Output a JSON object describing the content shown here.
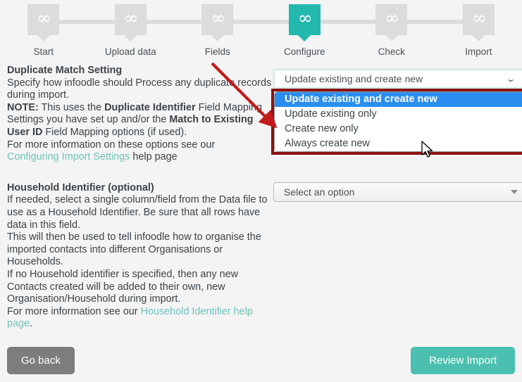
{
  "stepper": {
    "glyph": "∞",
    "steps": [
      {
        "label": "Start",
        "state": "inactive"
      },
      {
        "label": "Upload data",
        "state": "inactive"
      },
      {
        "label": "Fields",
        "state": "inactive"
      },
      {
        "label": "Configure",
        "state": "active"
      },
      {
        "label": "Check",
        "state": "inactive"
      },
      {
        "label": "Import",
        "state": "inactive"
      }
    ],
    "active_color": "#22b8ae",
    "inactive_color": "#dcdcdc"
  },
  "duplicate_section": {
    "heading": "Duplicate Match Setting",
    "line1": "Specify how infoodle should Process any duplicate records during import.",
    "note_label": "NOTE:",
    "note_part1": " This uses the ",
    "note_bold1": "Duplicate Identifier",
    "note_part2": " Field Mapping Settings you have set up and/or the ",
    "note_bold2": "Match to Existing User ID",
    "note_part3": " Field Mapping options (if used).",
    "more_info": "For more information on these options see our",
    "link_text": "Configuring Import Settings",
    "after_link": "help page"
  },
  "duplicate_select": {
    "value": "Update existing and create new",
    "chevron": "⌄",
    "options": [
      "Update existing and create new",
      "Update existing only",
      "Create new only",
      "Always create new"
    ],
    "selected_index": 0,
    "expanded": true,
    "highlight_color": "#2a8ef0",
    "annotation_box_color": "#8c1212",
    "focus_border_color": "#cfe8e3"
  },
  "household_section": {
    "heading": "Household Identifier (optional)",
    "para1": "If needed, select a single column/field from the Data file to use as a Household Identifier. Be sure that all rows have data in this field.",
    "para2": "This will then be used to tell infoodle how to organise the imported contacts into different Organisations or Households.",
    "para3": "If no Household identifier is specified, then any new Contacts created will be added to their own, new Organisation/Household during import.",
    "para4_pre": "For more information see our ",
    "link_text": "Household Identifier help page",
    "para4_post": "."
  },
  "household_select": {
    "value": "Select an option",
    "caret": "▾"
  },
  "footer": {
    "back_label": "Go back",
    "review_label": "Review Import",
    "back_color": "#7d7d7d",
    "review_color": "#4cc0b0"
  },
  "annotation": {
    "arrow_color": "#c01a1a",
    "type": "red-arrow"
  }
}
